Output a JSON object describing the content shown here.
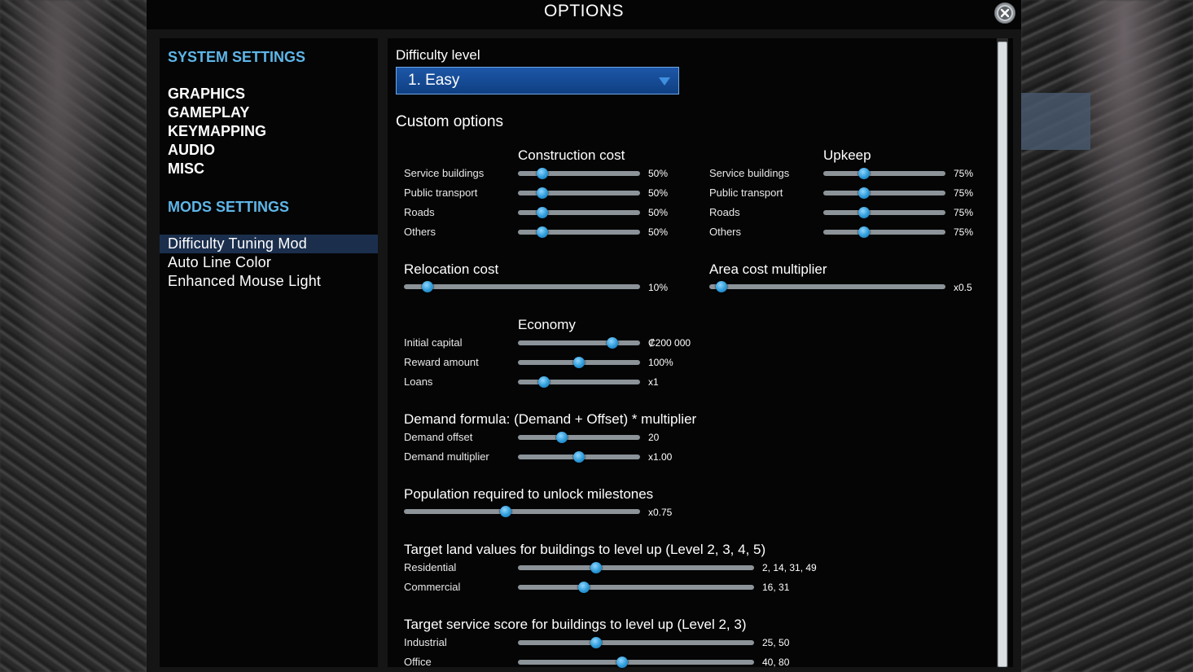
{
  "window": {
    "title": "OPTIONS"
  },
  "sidebar": {
    "system_heading": "SYSTEM SETTINGS",
    "system_items": [
      "GRAPHICS",
      "GAMEPLAY",
      "KEYMAPPING",
      "AUDIO",
      "MISC"
    ],
    "mods_heading": "MODS SETTINGS",
    "mods_items": [
      "Difficulty Tuning Mod",
      "Auto Line Color",
      "Enhanced Mouse Light"
    ],
    "selected_mod": "Difficulty Tuning Mod"
  },
  "difficulty": {
    "label": "Difficulty level",
    "value": "1. Easy"
  },
  "custom": {
    "title": "Custom options",
    "construction": {
      "heading": "Construction cost",
      "rows": [
        {
          "label": "Service buildings",
          "value": "50%",
          "level": 0.2
        },
        {
          "label": "Public transport",
          "value": "50%",
          "level": 0.2
        },
        {
          "label": "Roads",
          "value": "50%",
          "level": 0.2
        },
        {
          "label": "Others",
          "value": "50%",
          "level": 0.2
        }
      ]
    },
    "upkeep": {
      "heading": "Upkeep",
      "rows": [
        {
          "label": "Service buildings",
          "value": "75%",
          "level": 0.33
        },
        {
          "label": "Public transport",
          "value": "75%",
          "level": 0.33
        },
        {
          "label": "Roads",
          "value": "75%",
          "level": 0.33
        },
        {
          "label": "Others",
          "value": "75%",
          "level": 0.33
        }
      ]
    },
    "relocation": {
      "heading": "Relocation cost",
      "value": "10%",
      "level": 0.1
    },
    "area": {
      "heading": "Area cost multiplier",
      "value": "x0.5",
      "level": 0.05
    },
    "economy": {
      "heading": "Economy",
      "rows": [
        {
          "label": "Initial capital",
          "value": "₡200 000",
          "level": 0.77
        },
        {
          "label": "Reward amount",
          "value": "100%",
          "level": 0.5
        },
        {
          "label": "Loans",
          "value": "x1",
          "level": 0.21
        }
      ]
    },
    "demand": {
      "heading": "Demand formula: (Demand + Offset) * multiplier",
      "rows": [
        {
          "label": "Demand offset",
          "value": "20",
          "level": 0.36
        },
        {
          "label": "Demand multiplier",
          "value": "x1.00",
          "level": 0.5
        }
      ]
    },
    "population": {
      "heading": "Population required to unlock milestones",
      "value": "x0.75",
      "level": 0.43
    },
    "land_values": {
      "heading": "Target land values for buildings to level up (Level 2, 3, 4, 5)",
      "rows": [
        {
          "label": "Residential",
          "value": "2, 14, 31, 49",
          "level": 0.33
        },
        {
          "label": "Commercial",
          "value": "16, 31",
          "level": 0.28
        }
      ]
    },
    "service_score": {
      "heading": "Target service score for buildings to level up (Level 2, 3)",
      "rows": [
        {
          "label": "Industrial",
          "value": "25, 50",
          "level": 0.33
        },
        {
          "label": "Office",
          "value": "40, 80",
          "level": 0.44
        }
      ]
    }
  }
}
